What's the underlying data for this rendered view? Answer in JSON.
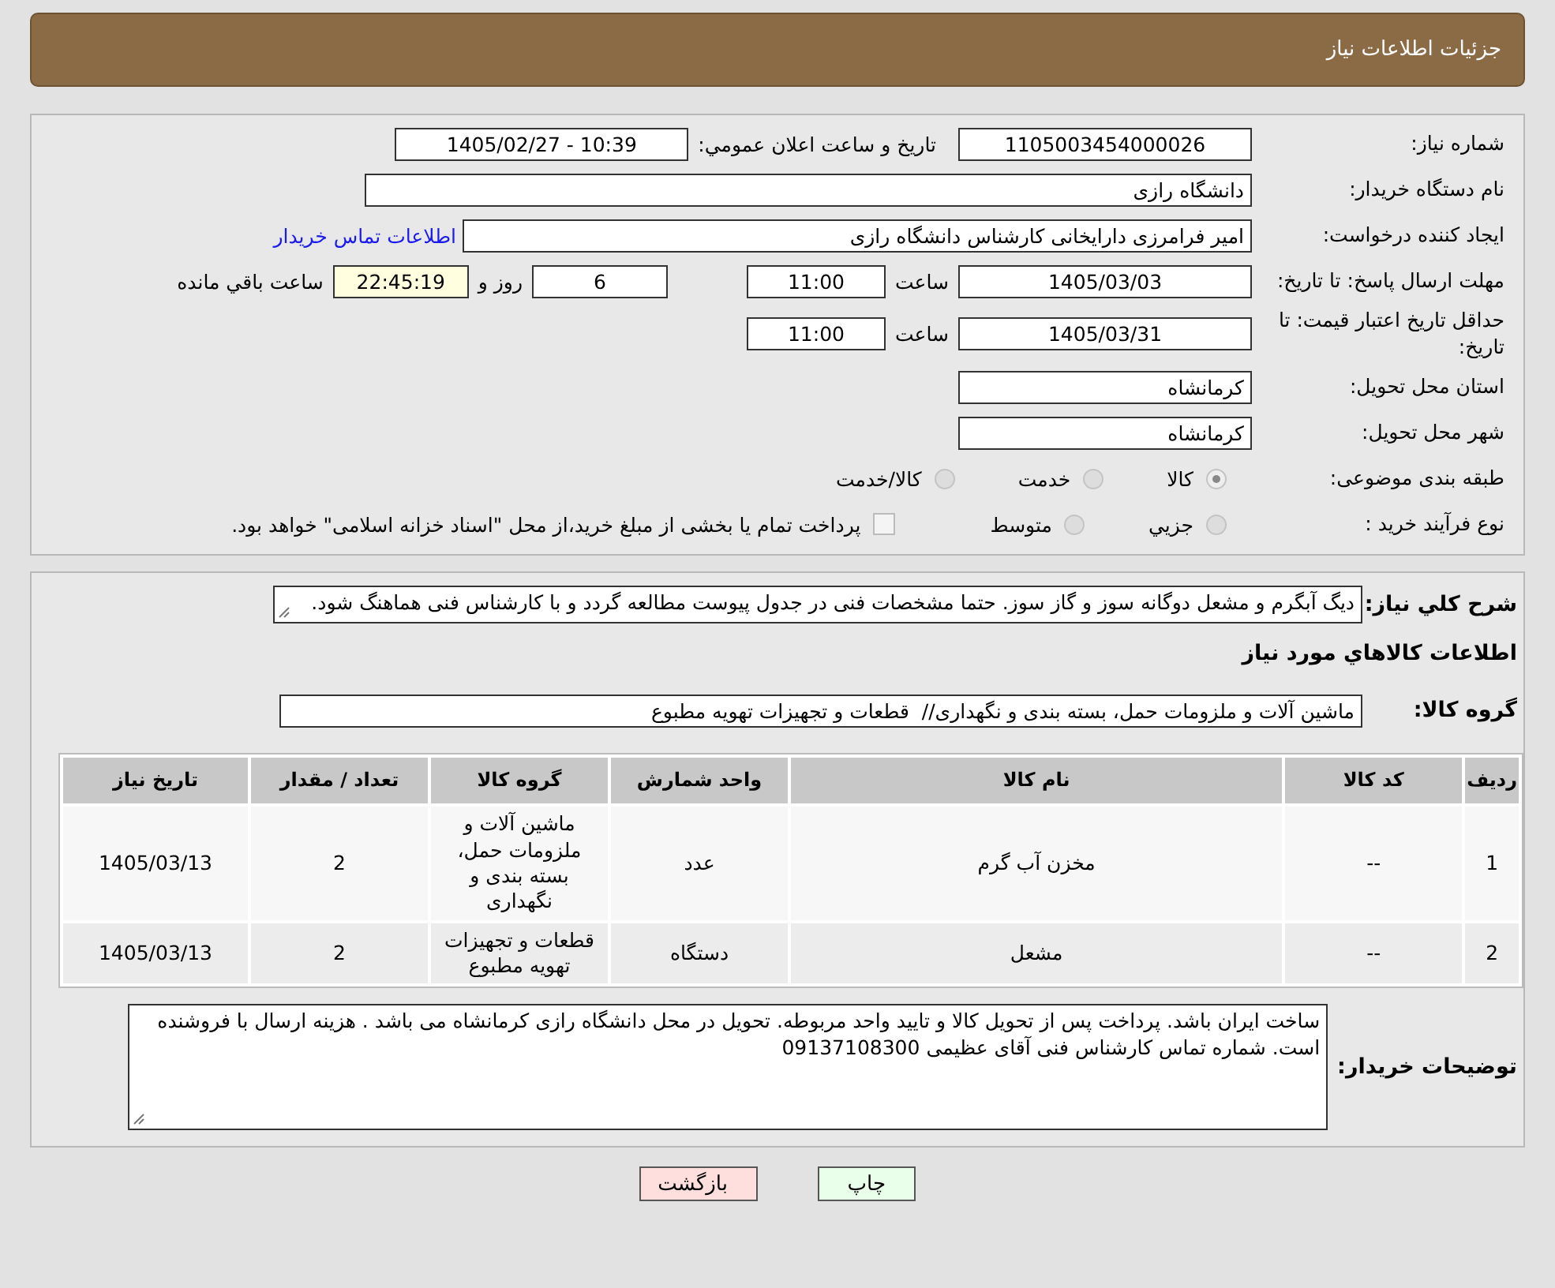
{
  "header": {
    "title": "جزئیات اطلاعات نیاز"
  },
  "details": {
    "need_number": {
      "label": "شماره نیاز:",
      "value": "1105003454000026"
    },
    "announce": {
      "label": "تاریخ و ساعت اعلان عمومي:",
      "value": "1405/02/27 - 10:39"
    },
    "buyer": {
      "label": "نام دستگاه خریدار:",
      "value": "دانشگاه رازی"
    },
    "creator": {
      "label": "ایجاد کننده درخواست:",
      "value": "امیر فرامرزی دارایخانی کارشناس دانشگاه رازی",
      "link": "اطلاعات تماس خریدار"
    },
    "deadline": {
      "label": "مهلت ارسال پاسخ: تا تاریخ:",
      "date": "1405/03/03",
      "time_label": "ساعت",
      "time": "11:00",
      "days": "6",
      "days_label": "روز و",
      "remaining": "22:45:19",
      "remaining_label": "ساعت باقي مانده"
    },
    "validity": {
      "label": "حداقل تاریخ اعتبار قیمت: تا تاریخ:",
      "date": "1405/03/31",
      "time_label": "ساعت",
      "time": "11:00"
    },
    "province": {
      "label": "استان محل تحویل:",
      "value": "کرمانشاه"
    },
    "city": {
      "label": "شهر محل تحویل:",
      "value": "کرمانشاه"
    },
    "classification": {
      "label": "طبقه بندی موضوعی:",
      "options": [
        {
          "label": "کالا",
          "selected": true
        },
        {
          "label": "خدمت",
          "selected": false
        },
        {
          "label": "کالا/خدمت",
          "selected": false
        }
      ]
    },
    "process": {
      "label": "نوع فرآیند خرید :",
      "options": [
        {
          "label": "جزيي",
          "selected": false
        },
        {
          "label": "متوسط",
          "selected": false
        }
      ],
      "payment": {
        "label": "پرداخت تمام یا بخشی از مبلغ خرید،از محل \"اسناد خزانه اسلامی\" خواهد بود.",
        "checked": false
      }
    }
  },
  "needs": {
    "description": {
      "label": "شرح کلي نیاز:",
      "value": "دیگ آبگرم و مشعل دوگانه سوز و گاز سوز. حتما مشخصات فنی در جدول پیوست مطالعه گردد و با کارشناس فنی هماهنگ شود."
    },
    "heading": "اطلاعات کالاهاي مورد نیاز",
    "group": {
      "label": "گروه کالا:",
      "value": "ماشین آلات و ملزومات حمل، بسته بندی و نگهداری//  قطعات و تجهیزات تهویه مطبوع"
    },
    "table": {
      "columns": [
        "ردیف",
        "کد کالا",
        "نام کالا",
        "واحد شمارش",
        "گروه کالا",
        "تعداد / مقدار",
        "تاریخ نیاز"
      ],
      "rows": [
        [
          "1",
          "--",
          "مخزن آب گرم",
          "عدد",
          "ماشین آلات و ملزومات حمل، بسته بندی و نگهداری",
          "2",
          "1405/03/13"
        ],
        [
          "2",
          "--",
          "مشعل",
          "دستگاه",
          "قطعات و تجهیزات تهویه مطبوع",
          "2",
          "1405/03/13"
        ]
      ]
    },
    "buyer_notes": {
      "label": "توضیحات خریدار:",
      "value": "ساخت ایران باشد. پرداخت پس از تحویل کالا و تایید واحد مربوطه. تحویل در محل دانشگاه رازی کرمانشاه می باشد . هزینه ارسال با فروشنده است. شماره تماس کارشناس فنی آقای عظیمی 09137108300"
    }
  },
  "buttons": [
    {
      "label": "چاپ",
      "kind": "print"
    },
    {
      "label": "بازگشت",
      "kind": "back"
    }
  ]
}
